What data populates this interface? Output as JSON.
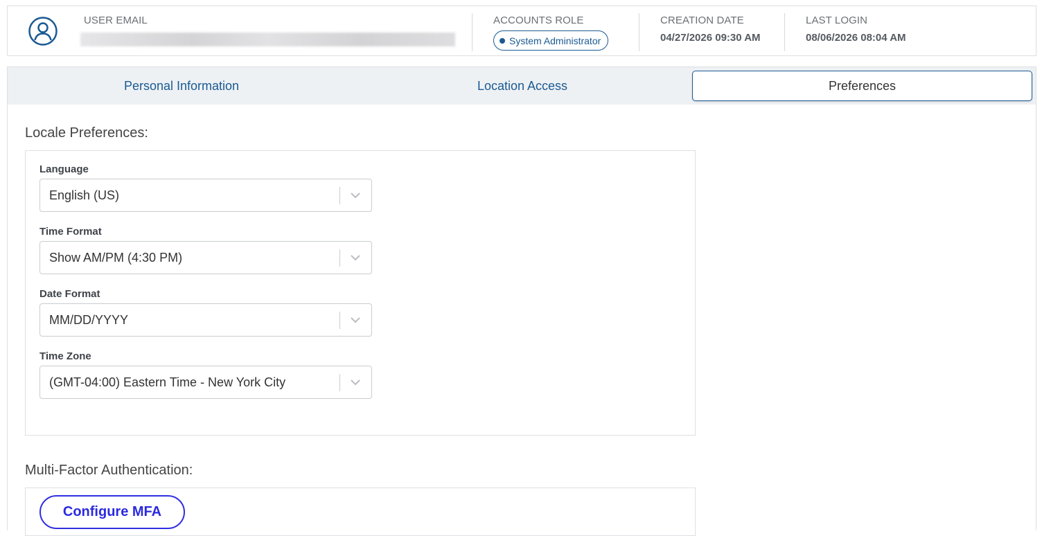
{
  "header": {
    "user_email_label": "USER EMAIL",
    "accounts_role_label": "ACCOUNTS ROLE",
    "accounts_role_value": "System Administrator",
    "creation_date_label": "CREATION DATE",
    "creation_date_value": "04/27/2026 09:30 AM",
    "last_login_label": "LAST LOGIN",
    "last_login_value": "08/06/2026 08:04 AM",
    "avatar_icon": "user-circle-icon"
  },
  "tabs": [
    {
      "label": "Personal Information",
      "active": false
    },
    {
      "label": "Location Access",
      "active": false
    },
    {
      "label": "Preferences",
      "active": true
    }
  ],
  "locale": {
    "title": "Locale Preferences:",
    "language": {
      "label": "Language",
      "value": "English (US)"
    },
    "time_format": {
      "label": "Time Format",
      "value": "Show AM/PM (4:30 PM)"
    },
    "date_format": {
      "label": "Date Format",
      "value": "MM/DD/YYYY"
    },
    "time_zone": {
      "label": "Time Zone",
      "value": "(GMT-04:00) Eastern Time - New York City"
    }
  },
  "mfa": {
    "title": "Multi-Factor Authentication:",
    "button_label": "Configure MFA"
  },
  "colors": {
    "accent": "#1b5a92",
    "mfa_button": "#2a2ae0",
    "tab_bar_bg": "#eef1f4"
  }
}
